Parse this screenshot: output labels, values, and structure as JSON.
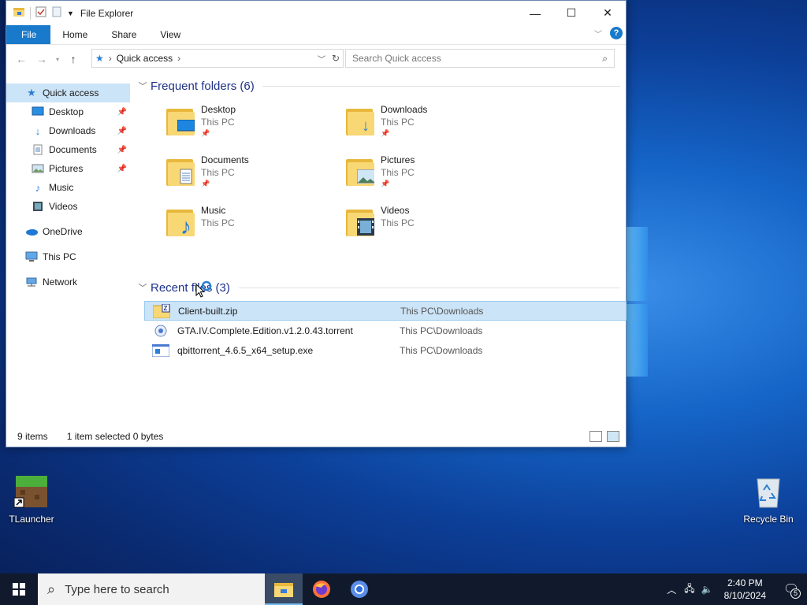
{
  "window": {
    "title": "File Explorer",
    "tabs": [
      "File",
      "Home",
      "Share",
      "View"
    ],
    "address": "Quick access",
    "search_placeholder": "Search Quick access"
  },
  "sidebar": {
    "items": [
      {
        "label": "Quick access",
        "icon": "star-icon"
      },
      {
        "label": "Desktop",
        "icon": "desktop-icon",
        "pinned": true
      },
      {
        "label": "Downloads",
        "icon": "download-icon",
        "pinned": true
      },
      {
        "label": "Documents",
        "icon": "documents-icon",
        "pinned": true
      },
      {
        "label": "Pictures",
        "icon": "pictures-icon",
        "pinned": true
      },
      {
        "label": "Music",
        "icon": "music-icon"
      },
      {
        "label": "Videos",
        "icon": "videos-icon"
      },
      {
        "label": "OneDrive",
        "icon": "onedrive-icon"
      },
      {
        "label": "This PC",
        "icon": "computer-icon"
      },
      {
        "label": "Network",
        "icon": "network-icon"
      }
    ]
  },
  "frequent": {
    "header": "Frequent folders (6)",
    "items": [
      {
        "name": "Desktop",
        "location": "This PC"
      },
      {
        "name": "Downloads",
        "location": "This PC"
      },
      {
        "name": "Documents",
        "location": "This PC"
      },
      {
        "name": "Pictures",
        "location": "This PC"
      },
      {
        "name": "Music",
        "location": "This PC"
      },
      {
        "name": "Videos",
        "location": "This PC"
      }
    ]
  },
  "recent": {
    "header": "Recent files (3)",
    "items": [
      {
        "name": "Client-built.zip",
        "location": "This PC\\Downloads"
      },
      {
        "name": "GTA.IV.Complete.Edition.v1.2.0.43.torrent",
        "location": "This PC\\Downloads"
      },
      {
        "name": "qbittorrent_4.6.5_x64_setup.exe",
        "location": "This PC\\Downloads"
      }
    ]
  },
  "status": {
    "items_count": "9 items",
    "selection": "1 item selected  0 bytes"
  },
  "desktop": {
    "icons": [
      "TLauncher",
      "Recycle Bin"
    ]
  },
  "taskbar": {
    "search_placeholder": "Type here to search",
    "time": "2:40 PM",
    "date": "8/10/2024",
    "notifications": "5"
  },
  "colors": {
    "accent": "#1979ca",
    "selection": "#cce4f7",
    "header_text": "#1e3287",
    "taskbar": "#101a2c"
  }
}
